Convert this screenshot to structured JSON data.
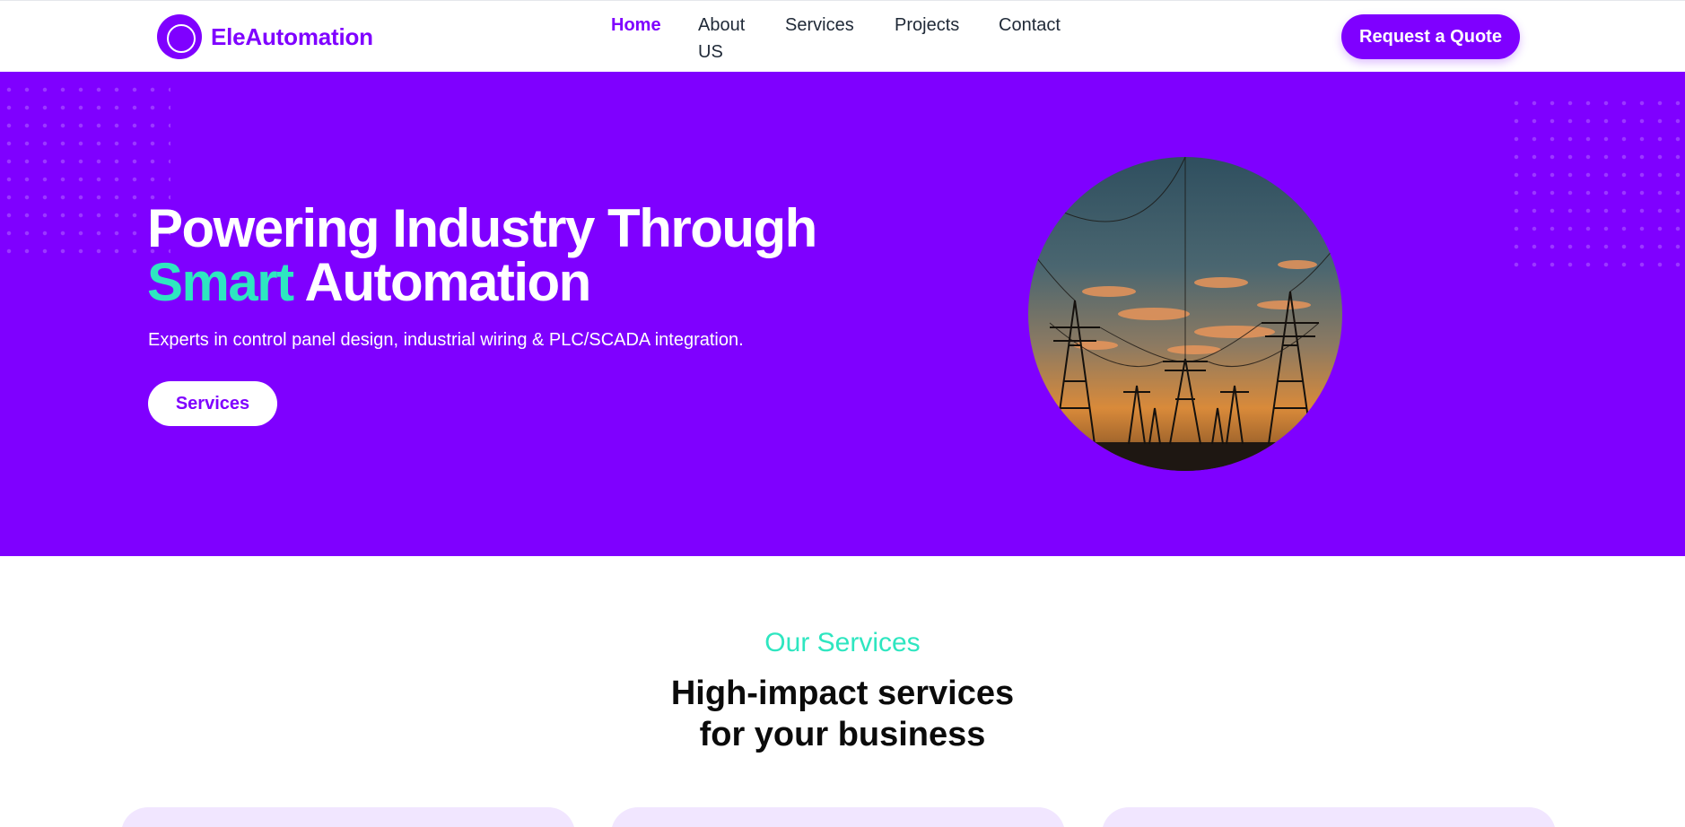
{
  "brand": {
    "name": "EleAutomation",
    "color": "#7f00ff"
  },
  "nav": {
    "items": [
      {
        "label": "Home",
        "active": true
      },
      {
        "label": "About US",
        "active": false
      },
      {
        "label": "Services",
        "active": false
      },
      {
        "label": "Projects",
        "active": false
      },
      {
        "label": "Contact",
        "active": false
      }
    ]
  },
  "header": {
    "cta_label": "Request a Quote"
  },
  "hero": {
    "title_line1": "Powering Industry Through",
    "title_accent": "Smart",
    "title_line2_rest": "Automation",
    "subtitle": "Experts in control panel design, industrial wiring & PLC/SCADA integration.",
    "button_label": "Services",
    "image": "transmission-towers-sunset",
    "background_color": "#7f00ff",
    "accent_color": "#2ee6c0"
  },
  "services": {
    "eyebrow": "Our Services",
    "heading_line1": "High-impact services",
    "heading_line2": "for your business"
  }
}
